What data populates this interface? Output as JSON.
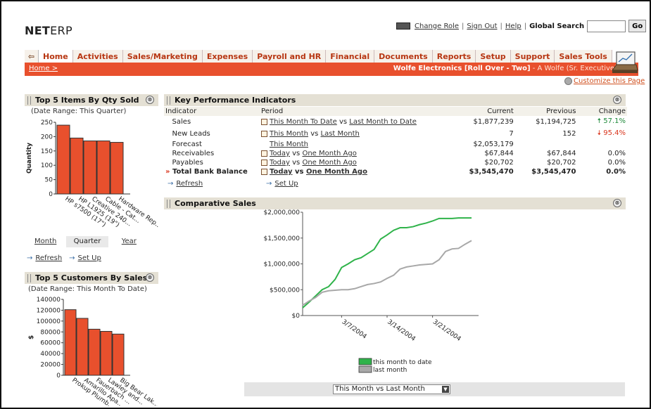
{
  "app": {
    "logo_bold": "NET",
    "logo_rest": "ERP"
  },
  "toplinks": {
    "change_role": "Change Role",
    "sign_out": "Sign Out",
    "help": "Help",
    "global_search_label": "Global Search",
    "search_value": "",
    "go": "Go",
    "sep": "|"
  },
  "nav": {
    "back_icon": "arrow-left-icon",
    "tabs": [
      "Home",
      "Activities",
      "Sales/Marketing",
      "Expenses",
      "Payroll and HR",
      "Financial",
      "Documents",
      "Reports",
      "Setup",
      "Support",
      "Sales Tools"
    ]
  },
  "breadcrumb": "Home >",
  "context": {
    "company": "Wolfe Electronics [Roll Over - Two]",
    "user": " - A Wolfe (Sr. Executive)"
  },
  "customize": "Customize this Page",
  "close_glyph": "⊗",
  "top_items": {
    "title": "Top 5 Items By Qty Sold",
    "range": "(Date Range: This Quarter)",
    "period_tabs": [
      "Month",
      "Quarter",
      "Year"
    ],
    "refresh": "Refresh",
    "setup": "Set Up"
  },
  "top_customers": {
    "title": "Top 5 Customers By Sales",
    "range": "(Date Range: This Month To Date)"
  },
  "kpi": {
    "title": "Key Performance Indicators",
    "headers": {
      "indicator": "Indicator",
      "period": "Period",
      "current": "Current",
      "previous": "Previous",
      "change": "Change"
    },
    "rows": [
      {
        "indicator": "Sales",
        "p1": "This Month To Date",
        "vs": "vs",
        "p2": "Last Month to Date",
        "current": "$1,877,239",
        "previous": "$1,194,725",
        "change": "57.1%",
        "dir": "up"
      },
      {
        "indicator": "New Leads",
        "p1": "This Month",
        "vs": "vs",
        "p2": "Last Month",
        "current": "7",
        "previous": "152",
        "change": "95.4%",
        "dir": "down"
      },
      {
        "indicator": "Forecast",
        "p1": "This Month",
        "vs": "",
        "p2": "",
        "current": "$2,053,179",
        "previous": "",
        "change": "",
        "dir": ""
      },
      {
        "indicator": "Receivables",
        "p1": "Today",
        "vs": "vs",
        "p2": "One Month Ago",
        "current": "$67,844",
        "previous": "$67,844",
        "change": "0.0%",
        "dir": ""
      },
      {
        "indicator": "Payables",
        "p1": "Today",
        "vs": "vs",
        "p2": "One Month Ago",
        "current": "$20,702",
        "previous": "$20,702",
        "change": "0.0%",
        "dir": ""
      },
      {
        "indicator": "Total Bank Balance",
        "p1": "Today",
        "vs": "vs",
        "p2": "One Month Ago",
        "current": "$3,545,470",
        "previous": "$3,545,470",
        "change": "0.0%",
        "dir": ""
      }
    ],
    "refresh": "Refresh",
    "setup": "Set Up"
  },
  "comparative": {
    "title": "Comparative Sales",
    "select_value": "This Month vs Last Month"
  },
  "colors": {
    "accent": "#e8502d",
    "bar": "#e8502d",
    "this_month": "#2fb34a",
    "last_month": "#a8a8a8"
  },
  "chart_data": [
    {
      "type": "bar",
      "categories": [
        "HP s7500 (17\")",
        "HP L1925 (19\")",
        "Creative 240...",
        "Cable - Cat...",
        "Hardware Rep..."
      ],
      "values": [
        240,
        195,
        185,
        185,
        180
      ],
      "ylabel": "Quantity",
      "ylim": [
        0,
        250
      ],
      "yticks": [
        0,
        50,
        100,
        150,
        200,
        250
      ]
    },
    {
      "type": "bar",
      "categories": [
        "Prokup Plumb...",
        "Amarillo Apa...",
        "Fauerbach ...",
        "Lawley and...",
        "Big Bear Lak..."
      ],
      "values": [
        121000,
        105000,
        85000,
        81000,
        76000
      ],
      "ylabel": "$",
      "ylim": [
        0,
        140000
      ],
      "yticks": [
        0,
        20000,
        40000,
        60000,
        80000,
        100000,
        120000,
        140000
      ]
    },
    {
      "type": "line",
      "x_ticks": [
        "3/7/2004",
        "3/14/2004",
        "3/21/2004"
      ],
      "ylim": [
        0,
        2000000
      ],
      "y_tick_labels": [
        "$0",
        "$500,000",
        "$1,000,000",
        "$1,500,000",
        "$2,000,000"
      ],
      "series": [
        {
          "name": "this month to date",
          "x": [
            1,
            2,
            3,
            4,
            5,
            6,
            7,
            8,
            9,
            10,
            11,
            12,
            13,
            14,
            15,
            16,
            17,
            18,
            19,
            20,
            21,
            22,
            23,
            24,
            25,
            26,
            27
          ],
          "values": [
            150000,
            260000,
            380000,
            500000,
            560000,
            700000,
            930000,
            1000000,
            1080000,
            1120000,
            1200000,
            1280000,
            1480000,
            1560000,
            1650000,
            1700000,
            1700000,
            1720000,
            1760000,
            1790000,
            1830000,
            1880000,
            1880000,
            1880000,
            1890000,
            1890000,
            1890000
          ]
        },
        {
          "name": "last month",
          "x": [
            1,
            2,
            3,
            4,
            5,
            6,
            7,
            8,
            9,
            10,
            11,
            12,
            13,
            14,
            15,
            16,
            17,
            18,
            19,
            20,
            21,
            22,
            23,
            24,
            25,
            26,
            27
          ],
          "values": [
            200000,
            280000,
            350000,
            450000,
            480000,
            490000,
            500000,
            500000,
            520000,
            560000,
            600000,
            620000,
            650000,
            720000,
            780000,
            900000,
            940000,
            960000,
            980000,
            990000,
            1000000,
            1080000,
            1240000,
            1290000,
            1300000,
            1380000,
            1450000
          ]
        }
      ]
    }
  ]
}
